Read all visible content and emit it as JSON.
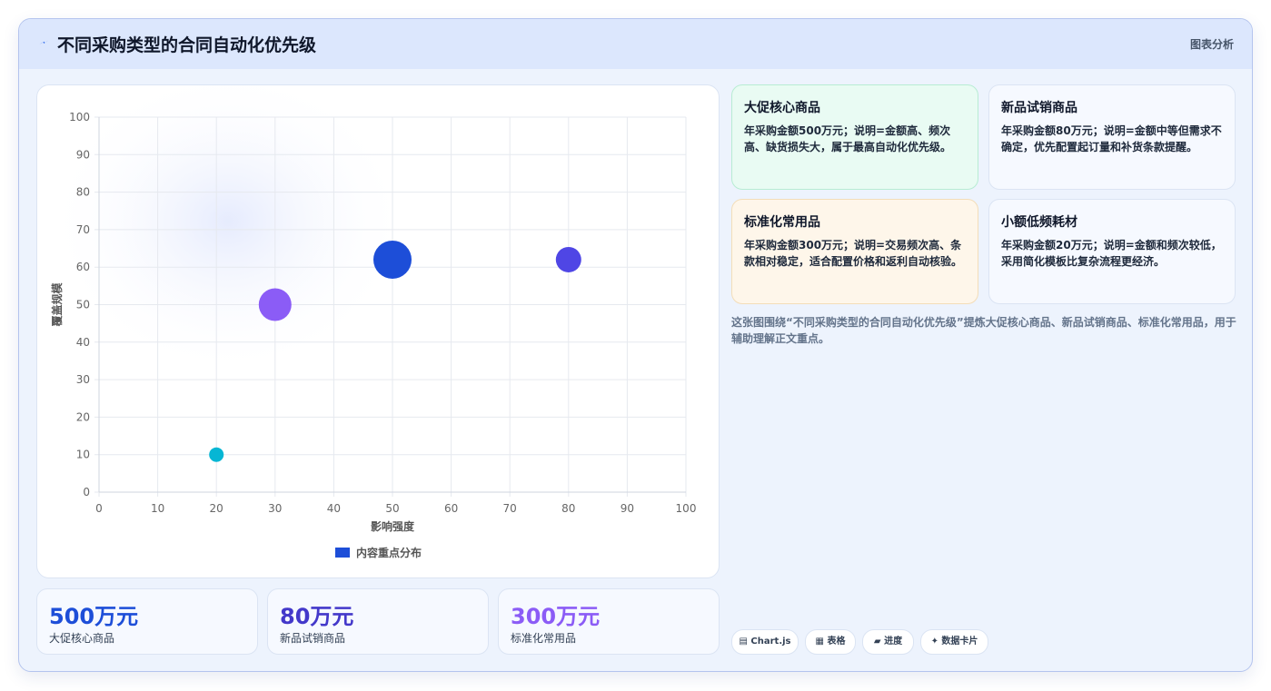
{
  "header": {
    "title": "不同采购类型的合同自动化优先级",
    "tag": "图表分析"
  },
  "chart_data": {
    "type": "scatter",
    "title": "",
    "xlabel": "影响强度",
    "ylabel": "覆盖规模",
    "xlim": [
      0,
      100
    ],
    "ylim": [
      0,
      100
    ],
    "xticks": [
      "0",
      "10",
      "20",
      "30",
      "40",
      "50",
      "60",
      "70",
      "80",
      "90",
      "100"
    ],
    "yticks": [
      "0",
      "10",
      "20",
      "30",
      "40",
      "50",
      "60",
      "70",
      "80",
      "90",
      "100"
    ],
    "grid": true,
    "legend_position": "bottom",
    "series": [
      {
        "name": "内容重点分布",
        "points": [
          {
            "x": 20,
            "y": 10,
            "r": 8,
            "color": "#06b6d4"
          },
          {
            "x": 30,
            "y": 50,
            "r": 18,
            "color": "#8b5cf6"
          },
          {
            "x": 50,
            "y": 62,
            "r": 21,
            "color": "#1d4ed8"
          },
          {
            "x": 80,
            "y": 62,
            "r": 14,
            "color": "#4f46e5"
          }
        ],
        "legend_color": "#1d4ed8"
      }
    ]
  },
  "stats": [
    {
      "value": "500万元",
      "label": "大促核心商品",
      "color": "#1d4ed8"
    },
    {
      "value": "80万元",
      "label": "新品试销商品",
      "color": "#4338ca"
    },
    {
      "value": "300万元",
      "label": "标准化常用品",
      "color": "#8b5cf6"
    }
  ],
  "cards": [
    {
      "title": "大促核心商品",
      "text": "年采购金额500万元；说明=金额高、频次高、缺货损失大，属于最高自动化优先级。",
      "bg": "#e9fbf3",
      "border": "#b7ecd3"
    },
    {
      "title": "新品试销商品",
      "text": "年采购金额80万元；说明=金额中等但需求不确定，优先配置起订量和补货条款提醒。",
      "bg": "#f6f9ff",
      "border": "#dbe4f3"
    },
    {
      "title": "标准化常用品",
      "text": "年采购金额300万元；说明=交易频次高、条款相对稳定，适合配置价格和返利自动核验。",
      "bg": "#fef6ea",
      "border": "#f3ddb8"
    },
    {
      "title": "小额低频耗材",
      "text": "年采购金额20万元；说明=金额和频次较低，采用简化模板比复杂流程更经济。",
      "bg": "#f6f9ff",
      "border": "#dbe4f3"
    }
  ],
  "description": "这张图围绕“不同采购类型的合同自动化优先级”提炼大促核心商品、新品试销商品、标准化常用品，用于辅助理解正文重点。",
  "pills": [
    {
      "icon": "chart-icon",
      "label": "▤ Chart.js"
    },
    {
      "icon": "table-icon",
      "label": "▦ 表格"
    },
    {
      "icon": "progress-icon",
      "label": "▰ 进度"
    },
    {
      "icon": "sparkle-icon",
      "label": "✦ 数据卡片"
    }
  ]
}
